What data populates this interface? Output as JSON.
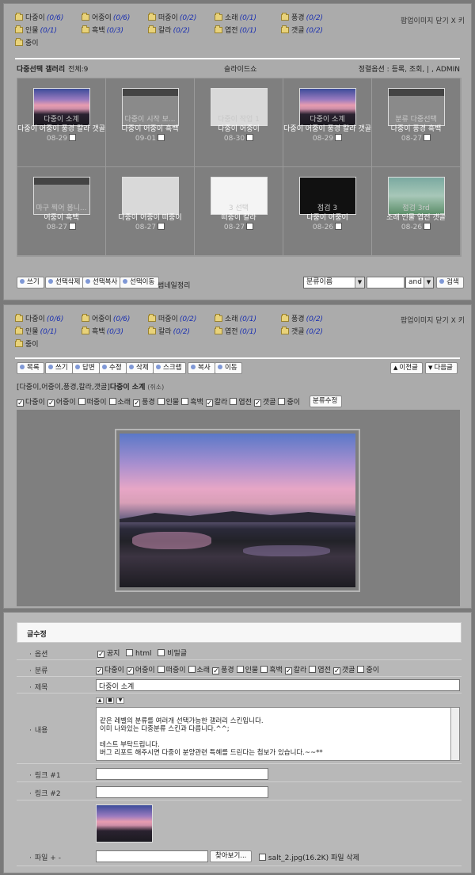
{
  "categories": [
    {
      "name": "다중이",
      "count": "(0/6)"
    },
    {
      "name": "어중이",
      "count": "(0/6)"
    },
    {
      "name": "떠중이",
      "count": "(0/2)"
    },
    {
      "name": "소래",
      "count": "(0/1)"
    },
    {
      "name": "풍경",
      "count": "(0/2)"
    },
    {
      "name": "인물",
      "count": "(0/1)"
    },
    {
      "name": "흑백",
      "count": "(0/3)"
    },
    {
      "name": "칼라",
      "count": "(0/2)"
    },
    {
      "name": "엽전",
      "count": "(0/1)"
    },
    {
      "name": "갯골",
      "count": "(0/2)"
    },
    {
      "name": "중이",
      "count": ""
    }
  ],
  "popup_close": "팝업이미지 닫기 X 키",
  "popup_close_2": "팝업이미지 닫기 X 키",
  "gallery": {
    "title": "다중선택 갤러리",
    "total": "전체:9",
    "slideshow": "슬라이드쇼",
    "sort": "정렬옵션 : 등록, 조회, | , ADMIN",
    "items": [
      {
        "name": "다중이 소계",
        "cats": "다중이 어중이 풍경 칼라 갯골",
        "date": "08-29",
        "thumb": "sky"
      },
      {
        "name": "다중이 시작 보...",
        "cats": "다중이 어중이 흑백",
        "date": "09-01",
        "thumb": "shot"
      },
      {
        "name": "다중이 작업 1",
        "cats": "다중이 어중이",
        "date": "08-30",
        "thumb": "win"
      },
      {
        "name": "다중이 소계",
        "cats": "다중이 어중이 풍경 칼라 갯골",
        "date": "08-29",
        "thumb": "sky"
      },
      {
        "name": "분류 다중선택",
        "cats": "다중이 풍경 흑백",
        "date": "08-27",
        "thumb": "shot"
      },
      {
        "name": "마구 찍어 봅니...",
        "cats": "어중이 흑백",
        "date": "08-27",
        "thumb": "shot"
      },
      {
        "name": "",
        "cats": "다중이 어중이 떠중이",
        "date": "08-27",
        "thumb": "win"
      },
      {
        "name": "3 선택",
        "cats": "떠중이 칼라",
        "date": "08-27",
        "thumb": "doc"
      },
      {
        "name": "점검 3",
        "cats": "다중이 어중이",
        "date": "08-26",
        "thumb": "pinkwin"
      },
      {
        "name": "점검 3rd",
        "cats": "소래 인물 엽전 갯골",
        "date": "08-26",
        "thumb": "people"
      }
    ]
  },
  "list_buttons": {
    "write": "쓰기",
    "delete_sel": "선택삭제",
    "copy_sel": "선택복사",
    "move_sel": "선택이동",
    "thumb_clean": "썸네일정리",
    "search_field": "분류이름",
    "search_op": "and",
    "search": "검색"
  },
  "view_buttons": {
    "list": "목록",
    "write": "쓰기",
    "reply": "답변",
    "edit": "수정",
    "delete": "삭제",
    "scrap": "스크랩",
    "copy": "복사",
    "move": "이동",
    "prev": "이전글",
    "next": "다음글"
  },
  "post": {
    "crumb": "[다중이,어중이,풍경,칼라,갯골]",
    "title": "다중이 소계",
    "author": "(쥐소)",
    "cat_checks": [
      {
        "name": "다중이",
        "on": true
      },
      {
        "name": "어중이",
        "on": true
      },
      {
        "name": "떠중이",
        "on": false
      },
      {
        "name": "소래",
        "on": false
      },
      {
        "name": "풍경",
        "on": true
      },
      {
        "name": "인물",
        "on": false
      },
      {
        "name": "흑백",
        "on": false
      },
      {
        "name": "칼라",
        "on": true
      },
      {
        "name": "엽전",
        "on": false
      },
      {
        "name": "갯골",
        "on": true
      },
      {
        "name": "중이",
        "on": false
      }
    ],
    "cat_edit": "분류수정"
  },
  "form": {
    "header": "글수정",
    "option_label": "옵션",
    "opt_notice": "공지",
    "opt_html": "html",
    "opt_secret": "비밀글",
    "cat_label": "분류",
    "subject_label": "제목",
    "subject_value": "다중이 소계",
    "content_label": "내용",
    "content_value": "같은 레벨의 분류를 여러개 선택가능한 갤러리 스킨입니다.\n이미 나와있는 다중분류 스킨과 다릅니다.^^;\n\n테스트 부탁드립니다.\n버그 리포트 해주시면 다중이 분양관련 특혜를 드린다는 첩보가 있습니다.~~**",
    "link1_label": "링크 #1",
    "link2_label": "링크 #2",
    "file_label": "파일 + -",
    "browse": "찾아보기...",
    "file_info": "salt_2.jpg(16.2K) 파일 삭제"
  }
}
